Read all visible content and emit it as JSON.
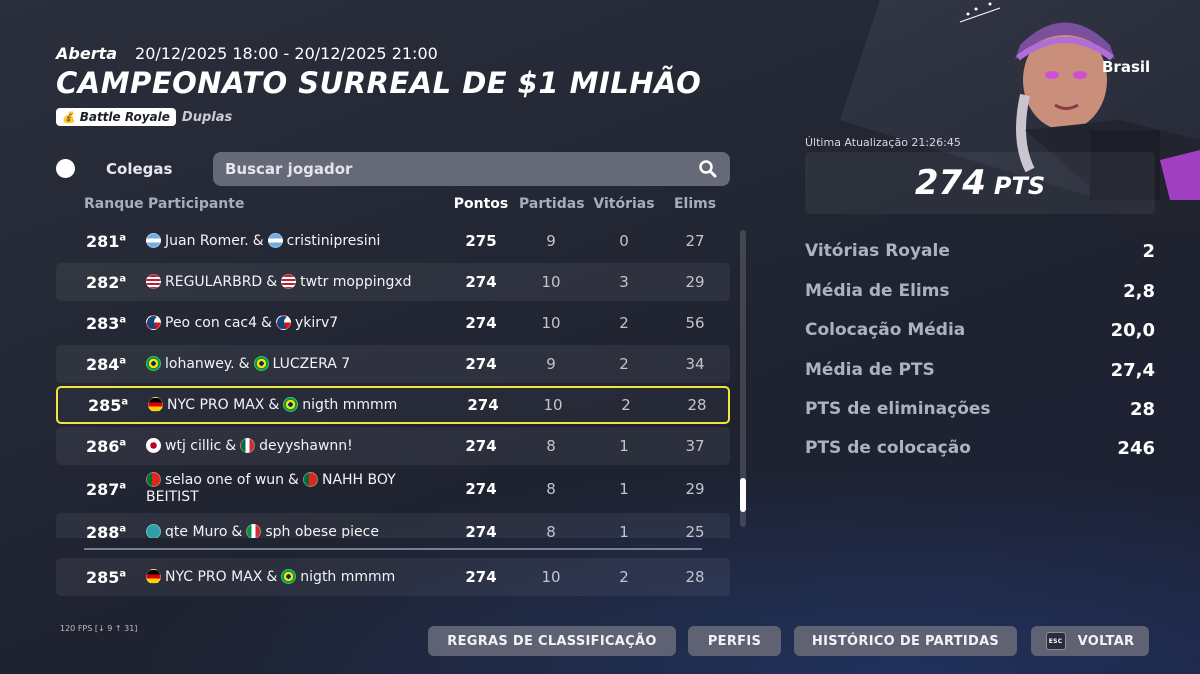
{
  "event": {
    "status": "Aberta",
    "datetime_range": "20/12/2025 18:00 - 20/12/2025 21:00",
    "title": "CAMPEONATO SURREAL DE $1 MILHÃO",
    "mode_badge": "Battle Royale",
    "mode_sub": "Duplas"
  },
  "toolbar": {
    "friends_label": "Colegas",
    "search_placeholder": "Buscar jogador"
  },
  "table": {
    "headers": {
      "rank": "Ranque",
      "participant": "Participante",
      "points": "Pontos",
      "matches": "Partidas",
      "wins": "Vitórias",
      "elims": "Elims"
    },
    "rows": [
      {
        "rank": "281",
        "suffix": "a",
        "p1": "Juan Romer.",
        "p1_flag": "ar",
        "p2": "cristinipresini",
        "p2_flag": "ar",
        "points": "275",
        "matches": "9",
        "wins": "0",
        "elims": "27"
      },
      {
        "rank": "282",
        "suffix": "a",
        "p1": "REGULARBRD",
        "p1_flag": "us",
        "p2": "twtr moppingxd",
        "p2_flag": "us",
        "points": "274",
        "matches": "10",
        "wins": "3",
        "elims": "29"
      },
      {
        "rank": "283",
        "suffix": "a",
        "p1": "Peo con cac4",
        "p1_flag": "cz",
        "p2": "ykirv7",
        "p2_flag": "cz",
        "points": "274",
        "matches": "10",
        "wins": "2",
        "elims": "56"
      },
      {
        "rank": "284",
        "suffix": "a",
        "p1": "lohanwey.",
        "p1_flag": "br",
        "p2": "LUCZERA 7",
        "p2_flag": "br",
        "points": "274",
        "matches": "9",
        "wins": "2",
        "elims": "34"
      },
      {
        "rank": "285",
        "suffix": "a",
        "p1": "NYC PRO MAX",
        "p1_flag": "de",
        "p2": "nigth mmmm",
        "p2_flag": "br",
        "points": "274",
        "matches": "10",
        "wins": "2",
        "elims": "28"
      },
      {
        "rank": "286",
        "suffix": "a",
        "p1": "wtj cillic",
        "p1_flag": "jp",
        "p2": "deyyshawnn!",
        "p2_flag": "mx",
        "points": "274",
        "matches": "8",
        "wins": "1",
        "elims": "37"
      },
      {
        "rank": "287",
        "suffix": "a",
        "p1": "selao one of wun",
        "p1_flag": "pt",
        "p2": "NAHH BOY BEITIST",
        "p2_flag": "pt",
        "points": "274",
        "matches": "8",
        "wins": "1",
        "elims": "29"
      },
      {
        "rank": "288",
        "suffix": "a",
        "p1": "qte Muro",
        "p1_flag": "globe",
        "p2": "sph obese piece",
        "p2_flag": "it",
        "points": "274",
        "matches": "8",
        "wins": "1",
        "elims": "25"
      }
    ],
    "own_row": {
      "rank": "285",
      "suffix": "a",
      "p1": "NYC PRO MAX",
      "p1_flag": "de",
      "p2": "nigth mmmm",
      "p2_flag": "br",
      "points": "274",
      "matches": "10",
      "wins": "2",
      "elims": "28"
    },
    "selected_index": 4
  },
  "player": {
    "country": "Brasil",
    "last_update": "Última Atualização 21:26:45",
    "points": "274",
    "points_unit": "PTS"
  },
  "stats": [
    {
      "label": "Vitórias Royale",
      "value": "2"
    },
    {
      "label": "Média de Elims",
      "value": "2,8"
    },
    {
      "label": "Colocação Média",
      "value": "20,0"
    },
    {
      "label": "Média de PTS",
      "value": "27,4"
    },
    {
      "label": "PTS de eliminações",
      "value": "28"
    },
    {
      "label": "PTS de colocação",
      "value": "246"
    }
  ],
  "footer": {
    "fps": "120 FPS [↓ 9 ↑ 31]",
    "rules_button": "REGRAS DE CLASSIFICAÇÃO",
    "profiles_button": "PERFIS",
    "history_button": "HISTÓRICO DE PARTIDAS",
    "back_key": "ESC",
    "back_button": "VOLTAR"
  },
  "flag_colors": {
    "ar": "#74acdf",
    "us": "#b22234",
    "cz": "#11457e",
    "br": "#009c3b",
    "de": "#dd0000",
    "jp": "#ffffff",
    "mx": "#006847",
    "pt": "#046a38",
    "it": "#009246",
    "globe": "#2e9fa8"
  },
  "colors": {
    "selected_outline": "#f0e63c",
    "button_bg": "#5e6273"
  }
}
